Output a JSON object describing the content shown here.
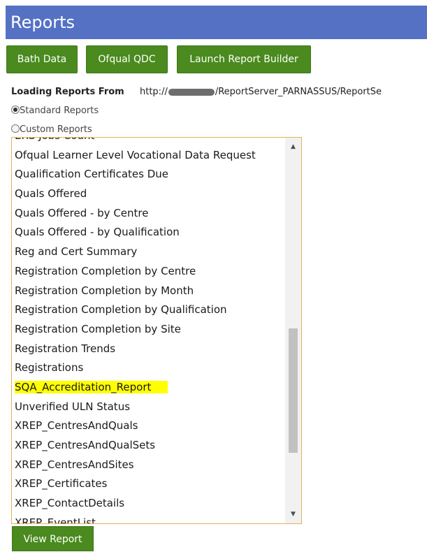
{
  "header": {
    "title": "Reports"
  },
  "toolbar": {
    "bath_data": "Bath Data",
    "ofqual_qdc": "Ofqual QDC",
    "launch_report_builder": "Launch Report Builder"
  },
  "loading": {
    "label": "Loading Reports From",
    "url_prefix": "http://",
    "url_suffix": "/ReportServer_PARNASSUS/ReportSe"
  },
  "report_source": {
    "options": [
      "Standard Reports",
      "Custom Reports"
    ],
    "selected": "Standard Reports"
  },
  "report_list": {
    "items": [
      "ERS Jobs Count",
      "Ofqual Learner Level Vocational Data Request",
      "Qualification Certificates Due",
      "Quals Offered",
      "Quals Offered - by Centre",
      "Quals Offered - by Qualification",
      "Reg and Cert Summary",
      "Registration Completion by Centre",
      "Registration Completion by Month",
      "Registration Completion by Qualification",
      "Registration Completion by Site",
      "Registration Trends",
      "Registrations",
      "SQA_Accreditation_Report",
      "Unverified ULN Status",
      "XREP_CentresAndQuals",
      "XREP_CentresAndQualSets",
      "XREP_CentresAndSites",
      "XREP_Certificates",
      "XREP_ContactDetails",
      "XREP_EventList"
    ],
    "highlighted": "SQA_Accreditation_Report",
    "highlight_color": "#ffff00",
    "border_color": "#e3b257"
  },
  "actions": {
    "view_report": "View Report"
  },
  "colors": {
    "header_bg": "#5471c4",
    "button_bg": "#4a8a1e"
  },
  "icons": {
    "scroll_up": "scroll-up-arrow-icon",
    "scroll_down": "scroll-down-arrow-icon"
  }
}
